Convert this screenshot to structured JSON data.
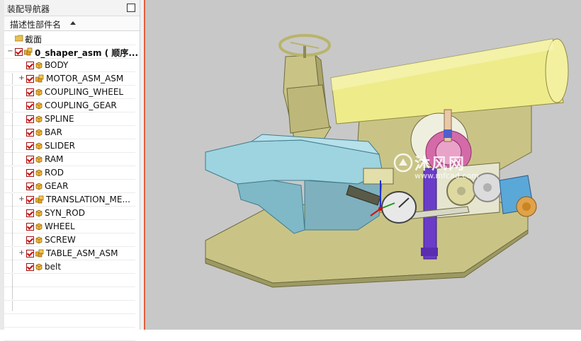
{
  "navigator": {
    "title": "装配导航器",
    "column_header": "描述性部件名",
    "items": [
      {
        "label": "截面",
        "kind": "folder",
        "expander": "",
        "checked": false
      },
      {
        "label": "0_shaper_asm ( 顺序...",
        "kind": "asm",
        "expander": "−",
        "checked": true
      },
      {
        "label": "BODY",
        "kind": "part",
        "expander": "",
        "checked": true
      },
      {
        "label": "MOTOR_ASM_ASM",
        "kind": "asm",
        "expander": "+",
        "checked": true
      },
      {
        "label": "COUPLING_WHEEL",
        "kind": "part",
        "expander": "",
        "checked": true
      },
      {
        "label": "COUPLING_GEAR",
        "kind": "part",
        "expander": "",
        "checked": true
      },
      {
        "label": "SPLINE",
        "kind": "part",
        "expander": "",
        "checked": true
      },
      {
        "label": "BAR",
        "kind": "part",
        "expander": "",
        "checked": true
      },
      {
        "label": "SLIDER",
        "kind": "part",
        "expander": "",
        "checked": true
      },
      {
        "label": "RAM",
        "kind": "part",
        "expander": "",
        "checked": true
      },
      {
        "label": "ROD",
        "kind": "part",
        "expander": "",
        "checked": true
      },
      {
        "label": "GEAR",
        "kind": "part",
        "expander": "",
        "checked": true
      },
      {
        "label": "TRANSLATION_ME...",
        "kind": "asm",
        "expander": "+",
        "checked": true
      },
      {
        "label": "SYN_ROD",
        "kind": "part",
        "expander": "",
        "checked": true
      },
      {
        "label": "WHEEL",
        "kind": "part",
        "expander": "",
        "checked": true
      },
      {
        "label": "SCREW",
        "kind": "part",
        "expander": "",
        "checked": true
      },
      {
        "label": "TABLE_ASM_ASM",
        "kind": "asm",
        "expander": "+",
        "checked": true
      },
      {
        "label": "belt",
        "kind": "part",
        "expander": "",
        "checked": true
      }
    ]
  },
  "watermark": {
    "title": "沐风网",
    "url": "www.mfcad.com"
  },
  "colors": {
    "viewport_bg": "#c8c8c8",
    "body_khaki": "#c9c486",
    "ram_yellow": "#eeeb8a",
    "table_blue": "#9ed3e0",
    "check_red": "#d00000"
  }
}
